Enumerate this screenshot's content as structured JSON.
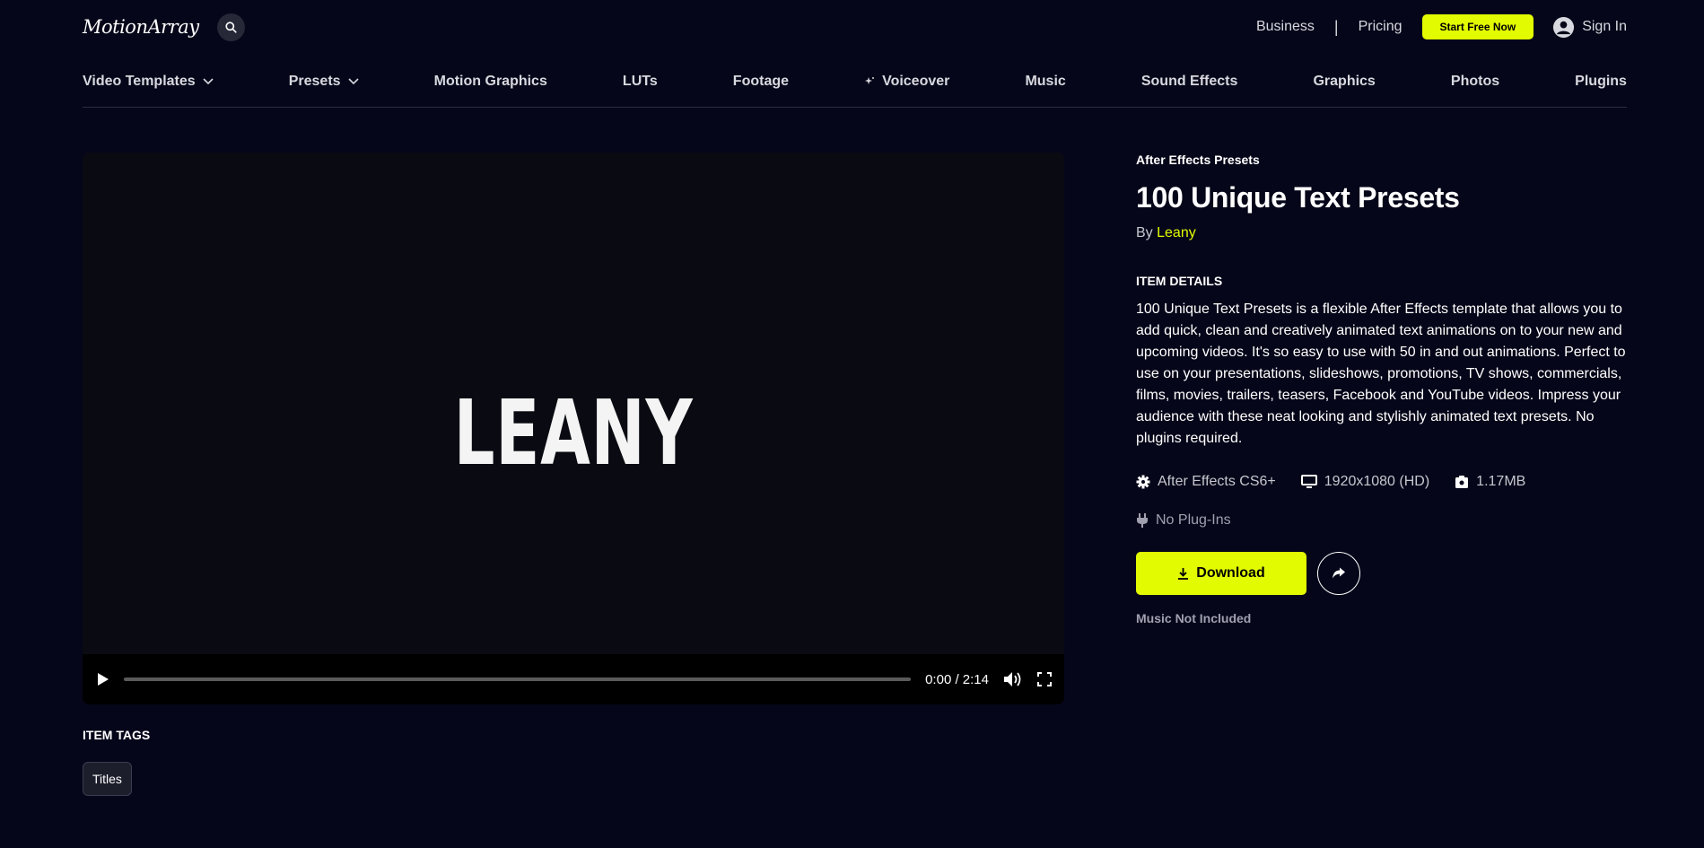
{
  "header": {
    "logo": "MotionArray",
    "business": "Business",
    "separator": "|",
    "pricing": "Pricing",
    "cta": "Start Free Now",
    "sign_in": "Sign In"
  },
  "nav": {
    "video_templates": "Video Templates",
    "presets": "Presets",
    "motion_graphics": "Motion Graphics",
    "luts": "LUTs",
    "footage": "Footage",
    "voiceover": "Voiceover",
    "music": "Music",
    "sound_effects": "Sound Effects",
    "graphics": "Graphics",
    "photos": "Photos",
    "plugins": "Plugins"
  },
  "video": {
    "title_text": "LEANY",
    "time": "0:00 / 2:14",
    "progress": 0
  },
  "tags": {
    "heading": "ITEM TAGS",
    "items": [
      "Titles"
    ]
  },
  "item": {
    "category": "After Effects Presets",
    "title": "100 Unique Text Presets",
    "by": "By",
    "author": "Leany",
    "details_heading": "ITEM DETAILS",
    "description": "100 Unique Text Presets is a flexible After Effects template that allows you to add quick, clean and creatively animated text animations on to your new and upcoming videos. It's so easy to use with 50 in and out animations. Perfect to use on your presentations, slideshows, promotions, TV shows, commercials, films, movies, trailers, teasers, Facebook and YouTube videos. Impress your audience with these neat looking and stylishly animated text presets. No plugins required.",
    "software": "After Effects CS6+",
    "resolution": "1920x1080 (HD)",
    "filesize": "1.17MB",
    "plugins": "No Plug-Ins",
    "download": "Download",
    "note": "Music Not Included"
  },
  "colors": {
    "background": "#050619",
    "accent": "#e2fb00"
  }
}
